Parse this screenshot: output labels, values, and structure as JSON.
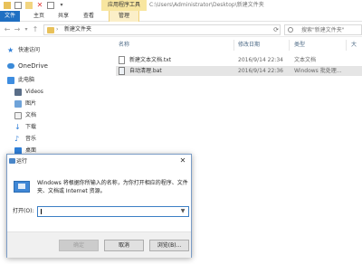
{
  "explorer": {
    "ribbon_context": "应用程序工具",
    "path_title": "C:\\Users\\Administrator\\Desktop\\新建文件夹",
    "tabs": {
      "file": "文件",
      "home": "主页",
      "share": "共享",
      "view": "查看",
      "manage": "管理"
    },
    "address": {
      "crumb": "新建文件夹",
      "search_placeholder": "搜索\"新建文件夹\""
    },
    "sidebar": {
      "items": [
        {
          "label": "快速访问",
          "icon": "star-icon"
        },
        {
          "label": "OneDrive",
          "icon": "cloud-icon"
        },
        {
          "label": "此电脑",
          "icon": "computer-icon"
        },
        {
          "label": "Videos",
          "icon": "video-icon"
        },
        {
          "label": "图片",
          "icon": "picture-icon"
        },
        {
          "label": "文档",
          "icon": "document-icon"
        },
        {
          "label": "下载",
          "icon": "download-icon"
        },
        {
          "label": "音乐",
          "icon": "music-icon"
        },
        {
          "label": "桌面",
          "icon": "desktop-icon"
        }
      ]
    },
    "columns": {
      "name": "名称",
      "date": "修改日期",
      "type": "类型",
      "size": "大"
    },
    "files": [
      {
        "name": "新建文本文档.txt",
        "date": "2016/9/14 22:34",
        "type": "文本文档"
      },
      {
        "name": "自动清理.bat",
        "date": "2016/9/14 22:36",
        "type": "Windows 批处理..."
      }
    ]
  },
  "run_dialog": {
    "title": "运行",
    "description": "Windows 将根据你所输入的名称，为你打开相应的程序、文件夹、文档或 Internet 资源。",
    "open_label": "打开(O):",
    "open_value": "",
    "buttons": {
      "ok": "确定",
      "cancel": "取消",
      "browse": "浏览(B)..."
    }
  }
}
